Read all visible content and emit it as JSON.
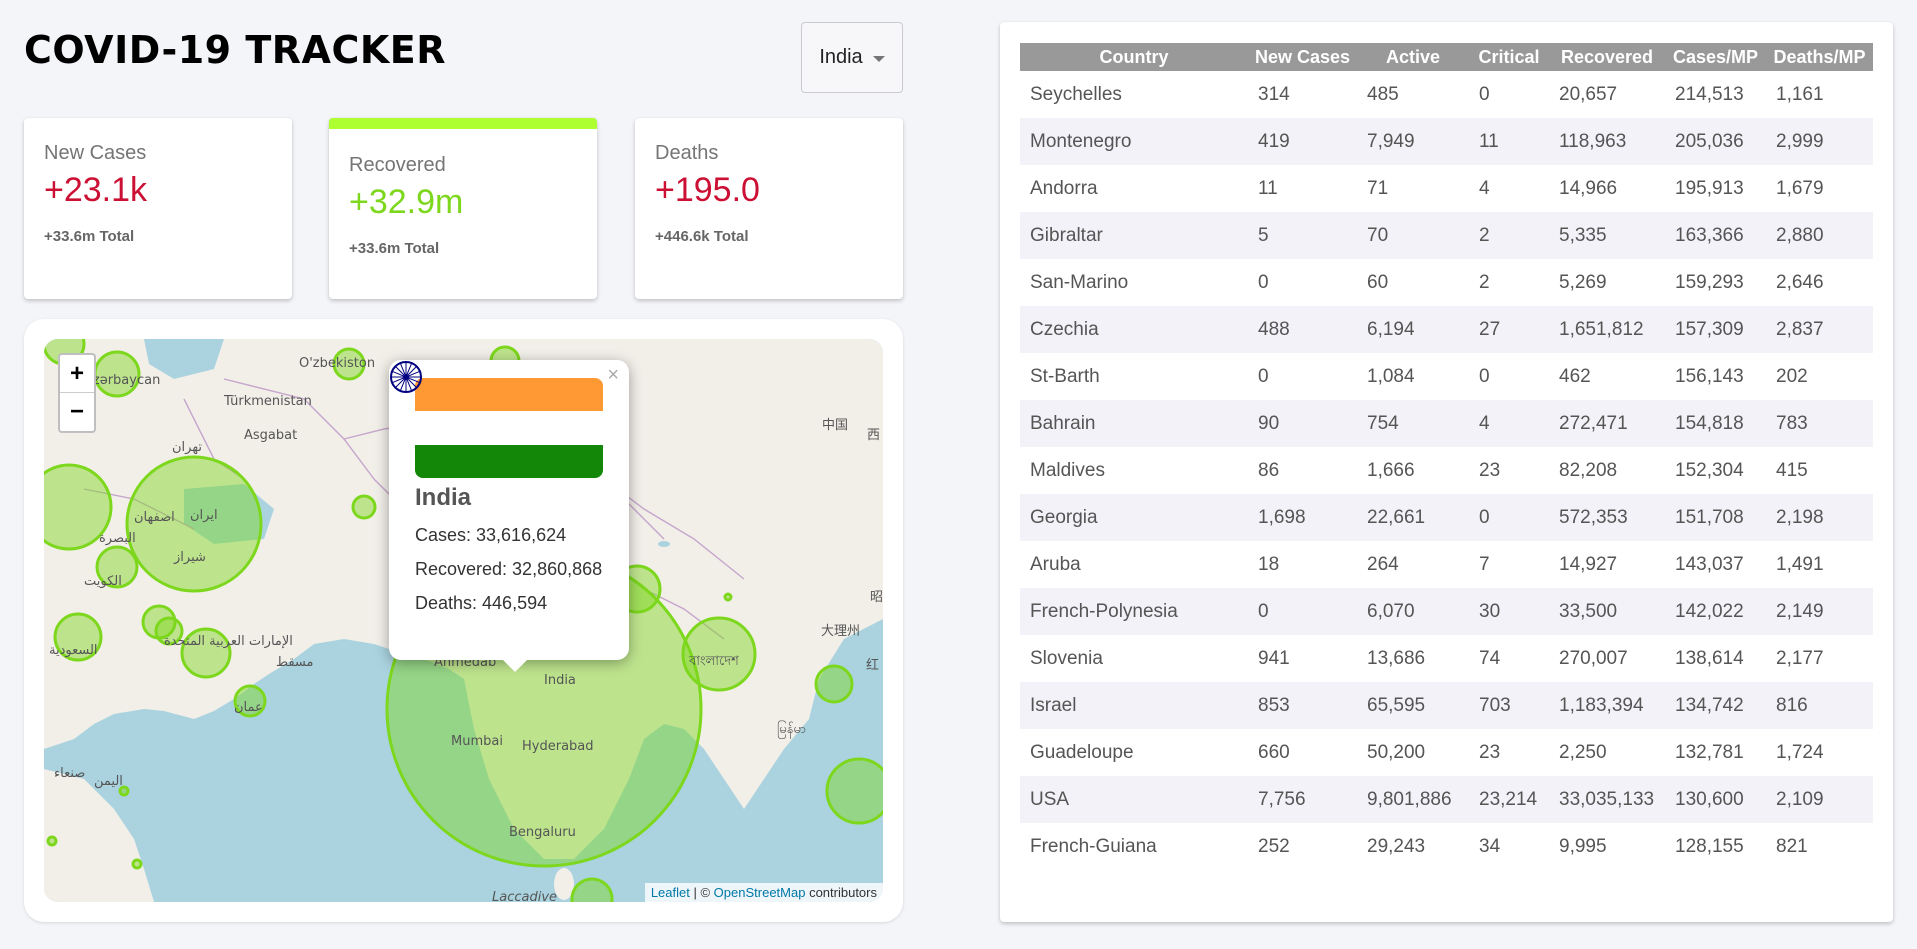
{
  "app": {
    "title": "COVID-19 TRACKER"
  },
  "country_select": {
    "value": "India"
  },
  "stats": [
    {
      "label": "New Cases",
      "value": "+23.1k",
      "total": "+33.6m Total",
      "color": "#cc1034",
      "selected": false
    },
    {
      "label": "Recovered",
      "value": "+32.9m",
      "total": "+33.6m Total",
      "color": "#7dd71d",
      "selected": true
    },
    {
      "label": "Deaths",
      "value": "+195.0",
      "total": "+446.6k Total",
      "color": "#cc1034",
      "selected": false
    }
  ],
  "map": {
    "zoom_in": "+",
    "zoom_out": "−",
    "popup": {
      "country": "India",
      "cases": "Cases: 33,616,624",
      "recovered": "Recovered: 32,860,868",
      "deaths": "Deaths: 446,594",
      "close": "×"
    },
    "labels": [
      "O'zbekiston",
      "Azərbaycan",
      "Türkmenistan",
      "Asgabat",
      "تهران",
      "ایران",
      "اصفهان",
      "شیراز",
      "البصرة",
      "الكويت",
      "السعودية",
      "الإمارات العربية المتحدة",
      "مسقط",
      "عمان",
      "صنعاء",
      "اليمن",
      "中国",
      "西",
      "大理州",
      "红",
      "昭",
      "India",
      "Ahmedab",
      "Mumbai",
      "Hyderabad",
      "Bengaluru",
      "বাংলাদেশ",
      "မြန်မာ",
      "Laccadive"
    ],
    "attribution": {
      "leaflet": "Leaflet",
      "separator": " | © ",
      "osm": "OpenStreetMap",
      "suffix": " contributors"
    },
    "circle_color": "#7dd71d"
  },
  "table": {
    "headers": [
      "Country",
      "New Cases",
      "Active",
      "Critical",
      "Recovered",
      "Cases/MP",
      "Deaths/MP"
    ],
    "rows": [
      [
        "Seychelles",
        "314",
        "485",
        "0",
        "20,657",
        "214,513",
        "1,161"
      ],
      [
        "Montenegro",
        "419",
        "7,949",
        "11",
        "118,963",
        "205,036",
        "2,999"
      ],
      [
        "Andorra",
        "11",
        "71",
        "4",
        "14,966",
        "195,913",
        "1,679"
      ],
      [
        "Gibraltar",
        "5",
        "70",
        "2",
        "5,335",
        "163,366",
        "2,880"
      ],
      [
        "San-Marino",
        "0",
        "60",
        "2",
        "5,269",
        "159,293",
        "2,646"
      ],
      [
        "Czechia",
        "488",
        "6,194",
        "27",
        "1,651,812",
        "157,309",
        "2,837"
      ],
      [
        "St-Barth",
        "0",
        "1,084",
        "0",
        "462",
        "156,143",
        "202"
      ],
      [
        "Bahrain",
        "90",
        "754",
        "4",
        "272,471",
        "154,818",
        "783"
      ],
      [
        "Maldives",
        "86",
        "1,666",
        "23",
        "82,208",
        "152,304",
        "415"
      ],
      [
        "Georgia",
        "1,698",
        "22,661",
        "0",
        "572,353",
        "151,708",
        "2,198"
      ],
      [
        "Aruba",
        "18",
        "264",
        "7",
        "14,927",
        "143,037",
        "1,491"
      ],
      [
        "French-Polynesia",
        "0",
        "6,070",
        "30",
        "33,500",
        "142,022",
        "2,149"
      ],
      [
        "Slovenia",
        "941",
        "13,686",
        "74",
        "270,007",
        "138,614",
        "2,177"
      ],
      [
        "Israel",
        "853",
        "65,595",
        "703",
        "1,183,394",
        "134,742",
        "816"
      ],
      [
        "Guadeloupe",
        "660",
        "50,200",
        "23",
        "2,250",
        "132,781",
        "1,724"
      ],
      [
        "USA",
        "7,756",
        "9,801,886",
        "23,214",
        "33,035,133",
        "130,600",
        "2,109"
      ],
      [
        "French-Guiana",
        "252",
        "29,243",
        "34",
        "9,995",
        "128,155",
        "821"
      ]
    ]
  }
}
